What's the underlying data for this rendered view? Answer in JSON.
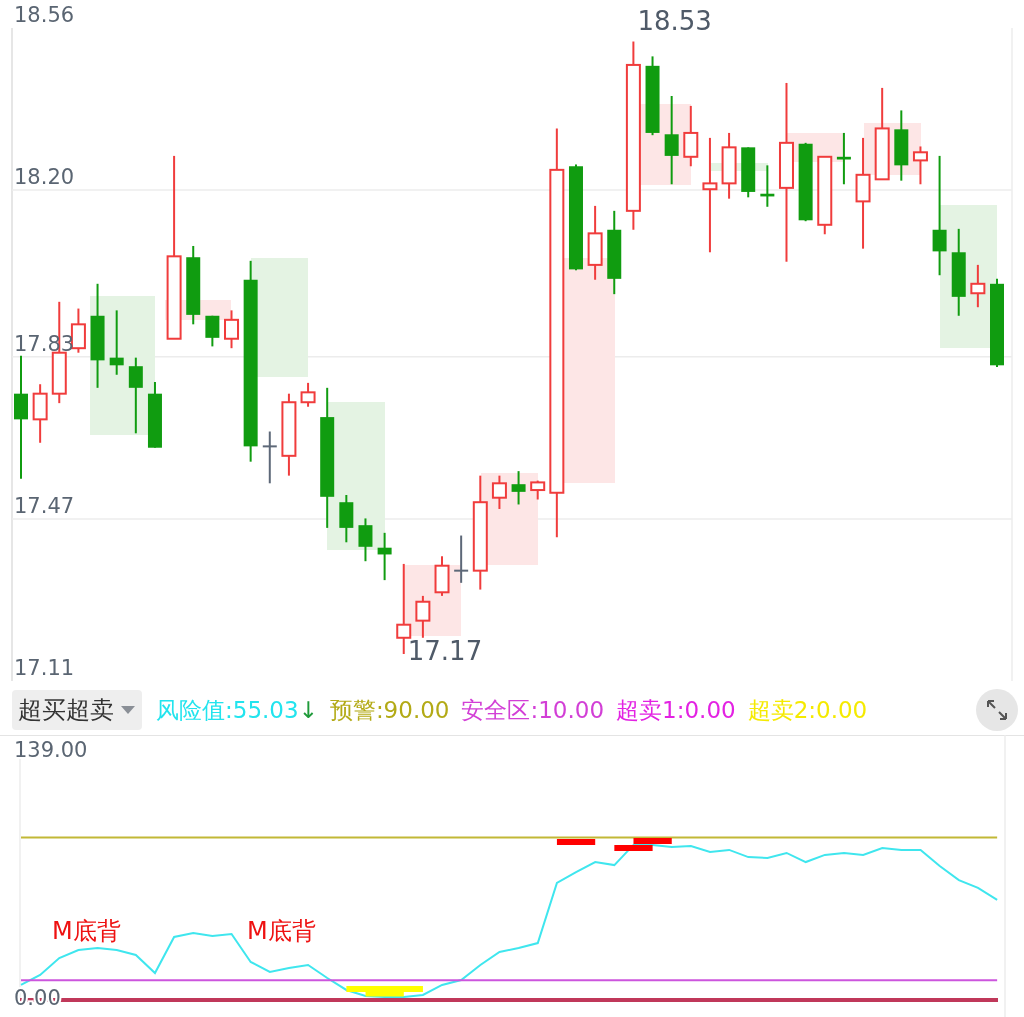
{
  "price_chart": {
    "chart_data": {
      "type": "candlestick",
      "ylim": [
        17.11,
        18.56
      ],
      "grid": true,
      "yticks": [
        {
          "value": 18.56,
          "label": "18.56"
        },
        {
          "value": 18.2,
          "label": "18.20"
        },
        {
          "value": 17.83,
          "label": "17.83"
        },
        {
          "value": 17.47,
          "label": "17.47"
        },
        {
          "value": 17.11,
          "label": "17.11"
        }
      ],
      "ohlc": [
        [
          17.748,
          17.832,
          17.559,
          17.691
        ],
        [
          17.691,
          17.769,
          17.639,
          17.748
        ],
        [
          17.748,
          17.952,
          17.727,
          17.839
        ],
        [
          17.849,
          17.937,
          17.839,
          17.902
        ],
        [
          17.921,
          17.992,
          17.761,
          17.822
        ],
        [
          17.828,
          17.933,
          17.79,
          17.811
        ],
        [
          17.809,
          17.828,
          17.66,
          17.761
        ],
        [
          17.748,
          17.774,
          17.628,
          17.628
        ],
        [
          17.87,
          18.276,
          17.87,
          18.053
        ],
        [
          18.051,
          18.076,
          17.902,
          17.923
        ],
        [
          17.921,
          17.921,
          17.853,
          17.872
        ],
        [
          17.87,
          17.933,
          17.849,
          17.912
        ],
        [
          18.001,
          18.043,
          17.597,
          17.631
        ],
        [
          17.631,
          17.664,
          17.549,
          17.631
        ],
        [
          17.61,
          17.748,
          17.566,
          17.729
        ],
        [
          17.729,
          17.772,
          17.719,
          17.751
        ],
        [
          17.696,
          17.761,
          17.45,
          17.519
        ],
        [
          17.507,
          17.523,
          17.418,
          17.45
        ],
        [
          17.456,
          17.471,
          17.376,
          17.408
        ],
        [
          17.406,
          17.439,
          17.334,
          17.391
        ],
        [
          17.206,
          17.37,
          17.17,
          17.235
        ],
        [
          17.244,
          17.299,
          17.206,
          17.286
        ],
        [
          17.307,
          17.387,
          17.299,
          17.366
        ],
        [
          17.355,
          17.433,
          17.328,
          17.355
        ],
        [
          17.355,
          17.566,
          17.313,
          17.507
        ],
        [
          17.517,
          17.566,
          17.492,
          17.549
        ],
        [
          17.547,
          17.576,
          17.502,
          17.53
        ],
        [
          17.534,
          17.555,
          17.513,
          17.551
        ],
        [
          17.528,
          18.337,
          17.429,
          18.245
        ],
        [
          18.253,
          18.257,
          18.022,
          18.024
        ],
        [
          18.034,
          18.165,
          18.001,
          18.104
        ],
        [
          18.112,
          18.154,
          17.969,
          18.003
        ],
        [
          18.154,
          18.53,
          18.112,
          18.478
        ],
        [
          18.476,
          18.497,
          18.322,
          18.327
        ],
        [
          18.324,
          18.409,
          18.213,
          18.276
        ],
        [
          18.274,
          18.387,
          18.253,
          18.327
        ],
        [
          18.202,
          18.316,
          18.062,
          18.215
        ],
        [
          18.215,
          18.327,
          18.181,
          18.295
        ],
        [
          18.295,
          18.295,
          18.184,
          18.196
        ],
        [
          18.192,
          18.255,
          18.163,
          18.186
        ],
        [
          18.205,
          18.438,
          18.041,
          18.305
        ],
        [
          18.303,
          18.305,
          18.131,
          18.133
        ],
        [
          18.123,
          18.274,
          18.102,
          18.274
        ],
        [
          18.274,
          18.327,
          18.213,
          18.268
        ],
        [
          18.175,
          18.316,
          18.07,
          18.234
        ],
        [
          18.224,
          18.427,
          18.224,
          18.337
        ],
        [
          18.335,
          18.377,
          18.221,
          18.255
        ],
        [
          18.266,
          18.297,
          18.213,
          18.284
        ],
        [
          18.112,
          18.276,
          18.011,
          18.064
        ],
        [
          18.062,
          18.114,
          17.921,
          17.963
        ],
        [
          17.971,
          18.034,
          17.94,
          17.992
        ],
        [
          17.992,
          18.003,
          17.807,
          17.811
        ]
      ],
      "annotations": [
        "18.53",
        "17.17"
      ]
    }
  },
  "indicator": {
    "selector": "超买超卖",
    "legend": [
      {
        "text": "风险值:55.03",
        "trend": "↓",
        "color": "#22e4ee"
      },
      {
        "text": "预警:90.00",
        "color": "#b3aa16"
      },
      {
        "text": "安全区:10.00",
        "color": "#d23fd6"
      },
      {
        "text": "超卖1:0.00",
        "color": "#e322e3"
      },
      {
        "text": "超卖2:0.00",
        "color": "#f5ea00"
      }
    ],
    "chart_data": {
      "type": "line",
      "ylim": [
        0,
        139
      ],
      "yticks": [
        {
          "value": 0,
          "label": "0.00"
        },
        {
          "value": 139,
          "label": "139.00"
        }
      ],
      "series": [
        {
          "color": "#3fe6ee",
          "values": [
            7.3,
            12.9,
            22.4,
            26.9,
            28.0,
            26.9,
            24.1,
            14.0,
            34.2,
            36.4,
            34.8,
            35.9,
            20.2,
            14.6,
            16.8,
            18.5,
            11.2,
            4.5,
            1.1,
            0.6,
            0.6,
            1.7,
            7.3,
            10.1,
            18.5,
            25.8,
            28.0,
            30.8,
            64.5,
            70.6,
            76.2,
            74.5,
            85.8,
            85.8,
            84.6,
            85.2,
            81.8,
            83.0,
            79.0,
            78.5,
            81.3,
            76.2,
            80.2,
            81.3,
            80.2,
            84.1,
            83.0,
            83.0,
            74.0,
            66.1,
            61.7,
            55.0
          ]
        },
        {
          "color": "#c2b836",
          "values": [
            90,
            90,
            90,
            90,
            90,
            90,
            90,
            90,
            90,
            90,
            90,
            90,
            90,
            90,
            90,
            90,
            90,
            90,
            90,
            90,
            90,
            90,
            90,
            90,
            90,
            90,
            90,
            90,
            90,
            90,
            90,
            90,
            90,
            90,
            90,
            90,
            90,
            90,
            90,
            90,
            90,
            90,
            90,
            90,
            90,
            90,
            90,
            90,
            90,
            90,
            90,
            90
          ]
        },
        {
          "color": "#cc55dd",
          "values": [
            10,
            10,
            10,
            10,
            10,
            10,
            10,
            10,
            10,
            10,
            10,
            10,
            10,
            10,
            10,
            10,
            10,
            10,
            10,
            10,
            10,
            10,
            10,
            10,
            10,
            10,
            10,
            10,
            10,
            10,
            10,
            10,
            10,
            10,
            10,
            10,
            10,
            10,
            10,
            10,
            10,
            10,
            10,
            10,
            10,
            10,
            10,
            10,
            10,
            10,
            10,
            10
          ]
        },
        {
          "color": "#ff0000",
          "values": [
            null,
            null,
            null,
            null,
            null,
            null,
            null,
            null,
            null,
            null,
            null,
            null,
            null,
            null,
            null,
            null,
            null,
            null,
            null,
            null,
            null,
            null,
            null,
            null,
            null,
            null,
            null,
            null,
            87.4,
            87.4,
            87.4,
            null,
            null,
            null,
            null,
            null,
            null,
            null,
            null,
            null,
            null,
            null,
            null,
            null,
            null,
            null,
            null,
            null,
            null,
            null,
            null,
            null
          ]
        },
        {
          "color": "#ff0000",
          "values": [
            null,
            null,
            null,
            null,
            null,
            null,
            null,
            null,
            null,
            null,
            null,
            null,
            null,
            null,
            null,
            null,
            null,
            null,
            null,
            null,
            null,
            null,
            null,
            null,
            null,
            null,
            null,
            null,
            null,
            null,
            null,
            84.1,
            84.1,
            84.1,
            null,
            null,
            null,
            null,
            null,
            null,
            null,
            null,
            null,
            null,
            null,
            null,
            null,
            null,
            null,
            null,
            null,
            null
          ]
        },
        {
          "color": "#ff0000",
          "values": [
            null,
            null,
            null,
            null,
            null,
            null,
            null,
            null,
            null,
            null,
            null,
            null,
            null,
            null,
            null,
            null,
            null,
            null,
            null,
            null,
            null,
            null,
            null,
            null,
            null,
            null,
            null,
            null,
            null,
            null,
            null,
            null,
            88.0,
            88.0,
            88.0,
            null,
            null,
            null,
            null,
            null,
            null,
            null,
            null,
            null,
            null,
            null,
            null,
            null,
            null,
            null,
            null,
            null
          ]
        },
        {
          "color": "#ffff00",
          "values": [
            null,
            null,
            null,
            null,
            null,
            null,
            null,
            null,
            null,
            null,
            null,
            null,
            null,
            null,
            null,
            null,
            null,
            5.0,
            5.0,
            5.0,
            5.0,
            5.0,
            null,
            null,
            null,
            null,
            null,
            null,
            null,
            null,
            null,
            null,
            null,
            null,
            null,
            null,
            null,
            null,
            null,
            null,
            null,
            null,
            null,
            null,
            null,
            null,
            null,
            null,
            null,
            null,
            null,
            null
          ]
        },
        {
          "color": "#ffff00",
          "values": [
            null,
            null,
            null,
            null,
            null,
            null,
            null,
            null,
            null,
            null,
            null,
            null,
            null,
            null,
            null,
            null,
            null,
            null,
            2.5,
            2.5,
            2.5,
            null,
            null,
            null,
            null,
            null,
            null,
            null,
            null,
            null,
            null,
            null,
            null,
            null,
            null,
            null,
            null,
            null,
            null,
            null,
            null,
            null,
            null,
            null,
            null,
            null,
            null,
            null,
            null,
            null,
            null,
            null
          ]
        }
      ],
      "annotations": [
        "M底背",
        "M底背"
      ]
    }
  }
}
